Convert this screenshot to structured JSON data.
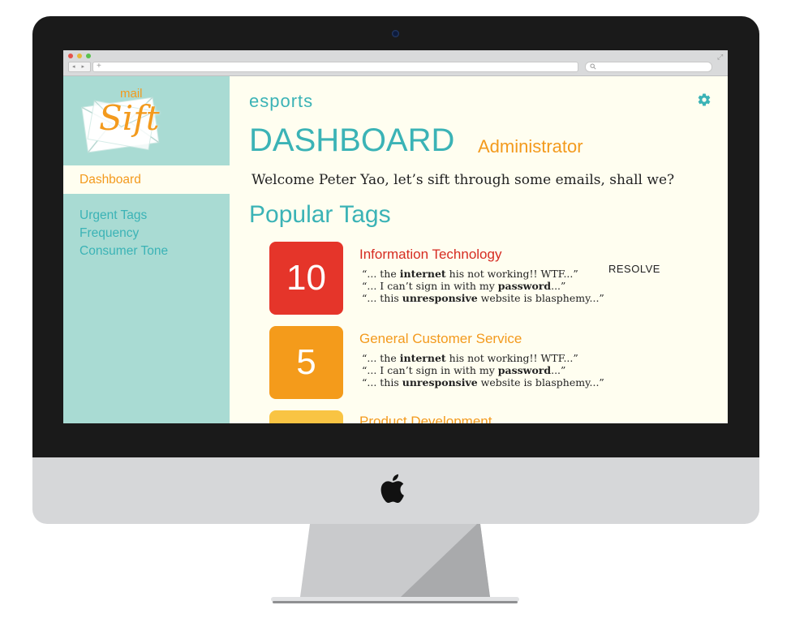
{
  "browser": {
    "url_placeholder": "+",
    "nav_buttons": "◂ ▸"
  },
  "sidebar": {
    "logo_small": "mail",
    "logo_main": "Sift",
    "active_item": "Dashboard",
    "items": [
      {
        "label": "Urgent Tags"
      },
      {
        "label": "Frequency"
      },
      {
        "label": "Consumer Tone"
      }
    ]
  },
  "header": {
    "organization": "esports",
    "title": "DASHBOARD",
    "role": "Administrator",
    "welcome": "Welcome Peter Yao, let’s sift through some emails, shall we?"
  },
  "popular_tags": {
    "title": "Popular Tags",
    "resolve_label": "RESOLVE",
    "tags": [
      {
        "count": "10",
        "name": "Information Technology",
        "color": "#e5352a",
        "name_color": "#d62b22",
        "quotes": [
          {
            "pre": "“... the ",
            "bold": "internet",
            "post": " his not working!! WTF...”"
          },
          {
            "pre": "“... I can’t sign in with my ",
            "bold": "password",
            "post": "...”"
          },
          {
            "pre": "“... this ",
            "bold": "unresponsive",
            "post": " website is blasphemy...”"
          }
        ]
      },
      {
        "count": "5",
        "name": "General Customer Service",
        "color": "#f49b1b",
        "name_color": "#f39a1d",
        "quotes": [
          {
            "pre": "“... the ",
            "bold": "internet",
            "post": " his not working!! WTF...”"
          },
          {
            "pre": "“... I can’t sign in with my ",
            "bold": "password",
            "post": "...”"
          },
          {
            "pre": "“... this ",
            "bold": "unresponsive",
            "post": " website is blasphemy...”"
          }
        ]
      },
      {
        "count": "",
        "name": "Product Development",
        "color": "#f9c443",
        "name_color": "#f39a1d"
      }
    ]
  },
  "icons": {
    "settings": "gear-icon",
    "search": "search-icon",
    "expand": "expand-icon",
    "hardware_logo": "apple-logo-icon"
  },
  "colors": {
    "teal": "#3bb3b6",
    "sidebar_bg": "#a9dbd3",
    "orange": "#f39a1d",
    "content_bg": "#fffef0"
  }
}
